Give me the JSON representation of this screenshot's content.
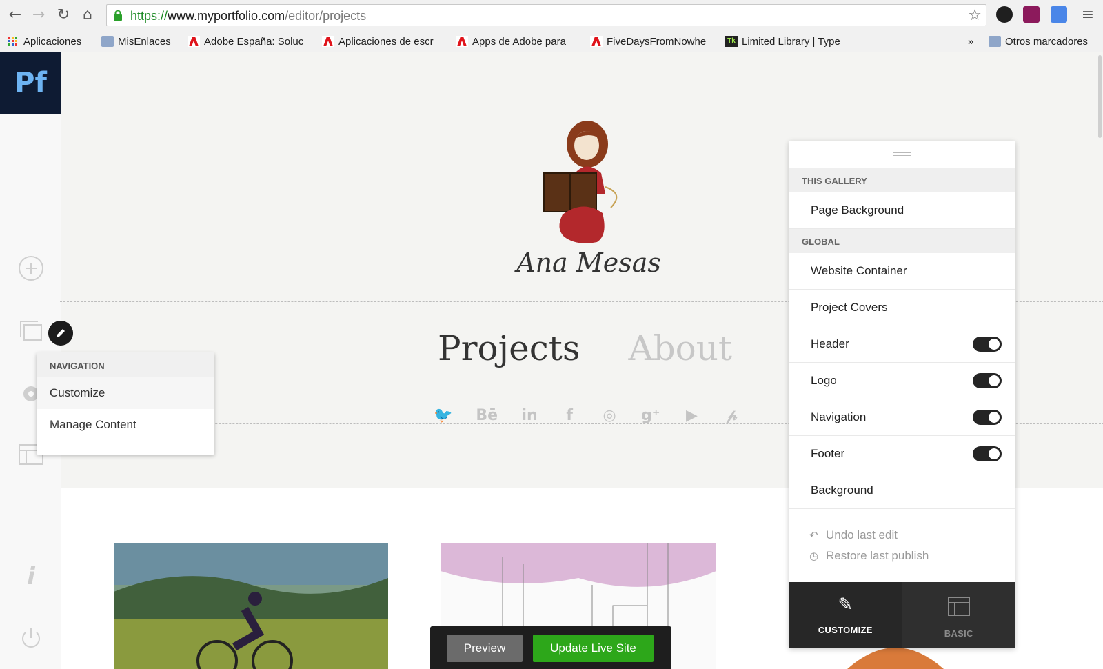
{
  "browser": {
    "url_scheme": "https://",
    "url_host": "www.myportfolio.com",
    "url_path": "/editor/projects",
    "bookmarks": [
      {
        "label": "Aplicaciones",
        "icon": "apps-grid-icon"
      },
      {
        "label": "MisEnlaces",
        "icon": "folder-icon"
      },
      {
        "label": "Adobe España: Soluc",
        "icon": "adobe-icon"
      },
      {
        "label": "Aplicaciones de escr",
        "icon": "adobe-icon"
      },
      {
        "label": "Apps de Adobe para",
        "icon": "adobe-icon"
      },
      {
        "label": "FiveDaysFromNowhe",
        "icon": "adobe-icon"
      },
      {
        "label": "Limited Library | Type",
        "icon": "typekit-icon"
      }
    ],
    "bookmarks_overflow": "»",
    "other_bookmarks": "Otros marcadores"
  },
  "app": {
    "logo": "Pf"
  },
  "site": {
    "name": "Ana Mesas",
    "nav": [
      "Projects",
      "About"
    ],
    "social": [
      "twitter-icon",
      "behance-icon",
      "linkedin-icon",
      "facebook-icon",
      "instagram-icon",
      "google-plus-icon",
      "youtube-icon",
      "pinterest-icon"
    ],
    "social_glyphs": [
      "🐦",
      "Bē",
      "in",
      "f",
      "◎",
      "g⁺",
      "▶",
      "𝓅"
    ]
  },
  "nav_popup": {
    "section": "NAVIGATION",
    "items": [
      "Customize",
      "Manage Content"
    ]
  },
  "panel": {
    "section_gallery": "THIS GALLERY",
    "gallery_items": [
      "Page Background"
    ],
    "section_global": "GLOBAL",
    "global_items": [
      {
        "label": "Website Container",
        "toggle": null
      },
      {
        "label": "Project Covers",
        "toggle": null
      },
      {
        "label": "Header",
        "toggle": true
      },
      {
        "label": "Logo",
        "toggle": true
      },
      {
        "label": "Navigation",
        "toggle": true
      },
      {
        "label": "Footer",
        "toggle": true
      },
      {
        "label": "Background",
        "toggle": null
      }
    ],
    "undo": "Undo last edit",
    "restore": "Restore last publish",
    "tabs": [
      {
        "label": "CUSTOMIZE",
        "icon": "pencil-icon",
        "active": true
      },
      {
        "label": "BASIC",
        "icon": "layout-icon",
        "active": false
      }
    ]
  },
  "publish_bar": {
    "preview": "Preview",
    "update": "Update Live Site"
  },
  "colors": {
    "accent_green": "#2da71a",
    "dark": "#272727",
    "app_logo_bg": "#0e1b33",
    "app_logo_fg": "#6db3f2"
  }
}
